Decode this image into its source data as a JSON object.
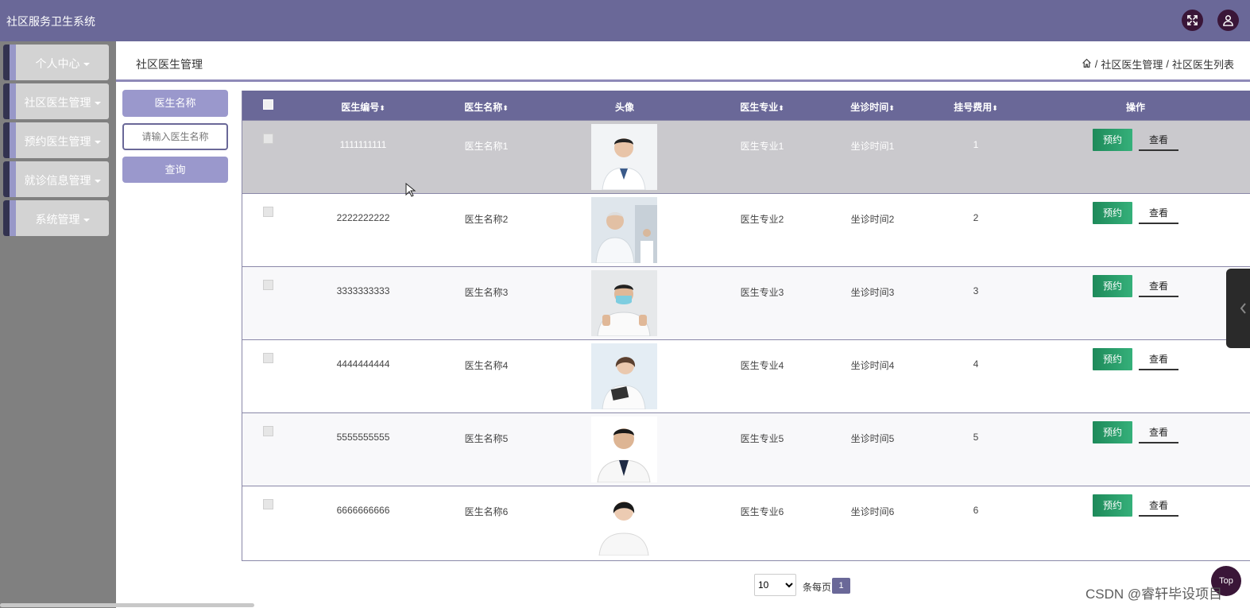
{
  "app": {
    "title": "社区服务卫生系统"
  },
  "sidebar": {
    "items": [
      {
        "label": "个人中心"
      },
      {
        "label": "社区医生管理"
      },
      {
        "label": "预约医生管理"
      },
      {
        "label": "就诊信息管理"
      },
      {
        "label": "系统管理"
      }
    ]
  },
  "header": {
    "title": "社区医生管理",
    "breadcrumb": [
      "社区医生管理",
      "社区医生列表"
    ]
  },
  "search": {
    "label": "医生名称",
    "placeholder": "请输入医生名称",
    "button": "查询"
  },
  "table": {
    "columns": {
      "id": "医生编号",
      "name": "医生名称",
      "avatar": "头像",
      "specialty": "医生专业",
      "time": "坐诊时间",
      "fee": "挂号费用",
      "actions": "操作"
    },
    "rows": [
      {
        "id": "1111111111",
        "name": "医生名称1",
        "specialty": "医生专业1",
        "time": "坐诊时间1",
        "fee": "1"
      },
      {
        "id": "2222222222",
        "name": "医生名称2",
        "specialty": "医生专业2",
        "time": "坐诊时间2",
        "fee": "2"
      },
      {
        "id": "3333333333",
        "name": "医生名称3",
        "specialty": "医生专业3",
        "time": "坐诊时间3",
        "fee": "3"
      },
      {
        "id": "4444444444",
        "name": "医生名称4",
        "specialty": "医生专业4",
        "time": "坐诊时间4",
        "fee": "4"
      },
      {
        "id": "5555555555",
        "name": "医生名称5",
        "specialty": "医生专业5",
        "time": "坐诊时间5",
        "fee": "5"
      },
      {
        "id": "6666666666",
        "name": "医生名称6",
        "specialty": "医生专业6",
        "time": "坐诊时间6",
        "fee": "6"
      }
    ],
    "actions": {
      "book": "预约",
      "view": "查看"
    }
  },
  "pagination": {
    "page_size": "10",
    "page_size_label": "条每页",
    "current_page": "1"
  },
  "back_to_top": "Top",
  "watermark": "CSDN @睿轩毕设项目",
  "colors": {
    "primary": "#6a6898",
    "book_button": "#1e8a5a",
    "hover_row": "#cac9cd",
    "dark_icon": "#3a1638"
  },
  "icons": {
    "fullscreen": "fullscreen-icon",
    "user": "user-icon",
    "home": "home-icon"
  }
}
